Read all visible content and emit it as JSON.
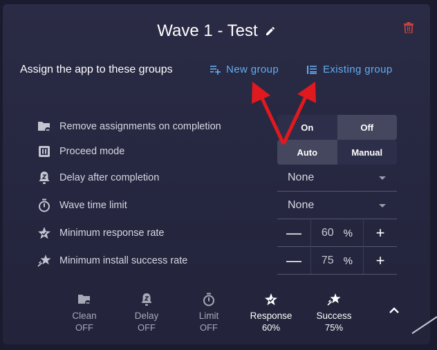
{
  "dialog": {
    "title": "Wave 1 - Test",
    "edit_icon": "pencil-icon",
    "delete_icon": "trash-icon"
  },
  "assign": {
    "label": "Assign the app to these groups",
    "new_group": "New group",
    "existing_group": "Existing group"
  },
  "settings": {
    "remove_assignments": {
      "label": "Remove assignments on completion",
      "options": [
        "On",
        "Off"
      ],
      "selected": "Off"
    },
    "proceed_mode": {
      "label": "Proceed mode",
      "options": [
        "Auto",
        "Manual"
      ],
      "selected": "Auto"
    },
    "delay": {
      "label": "Delay after completion",
      "value": "None"
    },
    "time_limit": {
      "label": "Wave time limit",
      "value": "None"
    },
    "min_response": {
      "label": "Minimum response rate",
      "value": "60",
      "unit": "%",
      "minus": "—",
      "plus": "+"
    },
    "min_install": {
      "label": "Minimum install success rate",
      "value": "75",
      "unit": "%",
      "minus": "—",
      "plus": "+"
    }
  },
  "summary": [
    {
      "name": "Clean",
      "state": "OFF"
    },
    {
      "name": "Delay",
      "state": "OFF"
    },
    {
      "name": "Limit",
      "state": "OFF"
    },
    {
      "name": "Response",
      "state": "60%"
    },
    {
      "name": "Success",
      "state": "75%"
    }
  ],
  "colors": {
    "link": "#62aef3",
    "delete": "#d0423f",
    "annotation_arrow": "#e0191e"
  }
}
